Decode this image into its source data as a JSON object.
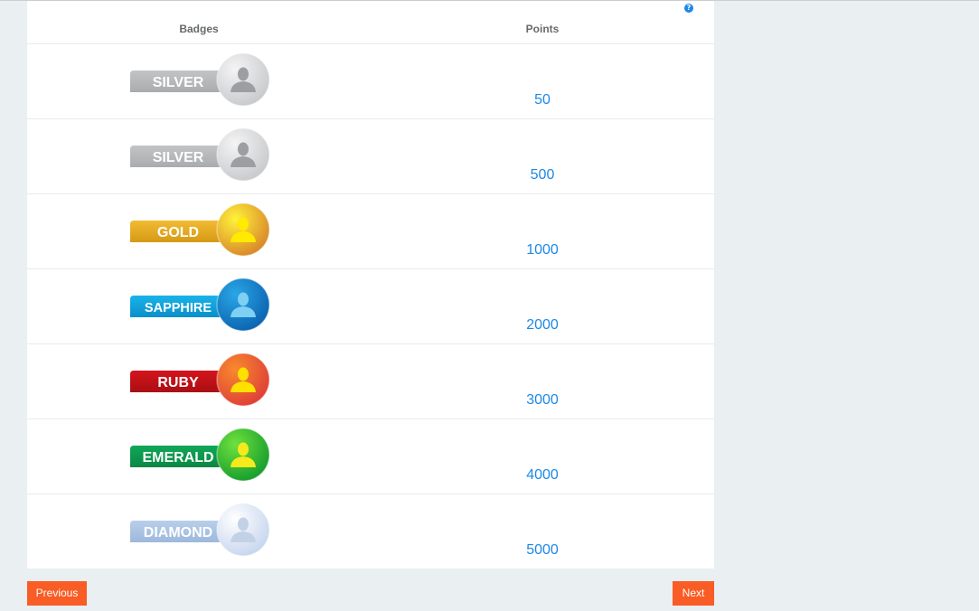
{
  "table": {
    "headers": {
      "badges": "Badges",
      "points": "Points"
    },
    "help_icon": "question-circle-icon",
    "rows": [
      {
        "badge": "SILVER",
        "points": "50",
        "ribbon": "#c2c4c6",
        "ribbon_dark": "#a9abae",
        "circle": [
          "#f4f4f5",
          "#c8c9cb"
        ],
        "person": "#9c9ea1",
        "text": "#ffffff"
      },
      {
        "badge": "SILVER",
        "points": "500",
        "ribbon": "#c2c4c6",
        "ribbon_dark": "#a9abae",
        "circle": [
          "#f4f4f5",
          "#c8c9cb"
        ],
        "person": "#9c9ea1",
        "text": "#ffffff"
      },
      {
        "badge": "GOLD",
        "points": "1000",
        "ribbon": "#f2bb33",
        "ribbon_dark": "#d59a16",
        "circle": [
          "#fff23a",
          "#d8862a"
        ],
        "person": "#ffea00",
        "text": "#ffffff"
      },
      {
        "badge": "SAPPHIRE",
        "points": "2000",
        "ribbon": "#19b3ea",
        "ribbon_dark": "#0b8fc9",
        "circle": [
          "#2aa6e6",
          "#0b63b0"
        ],
        "person": "#7fd0f3",
        "text": "#ffffff"
      },
      {
        "badge": "RUBY",
        "points": "3000",
        "ribbon": "#d4141c",
        "ribbon_dark": "#a90f14",
        "circle": [
          "#f88a2e",
          "#de3e37"
        ],
        "person": "#ffe100",
        "text": "#ffffff"
      },
      {
        "badge": "EMERALD",
        "points": "4000",
        "ribbon": "#0fa857",
        "ribbon_dark": "#0b8744",
        "circle": [
          "#6fe13e",
          "#159c2d"
        ],
        "person": "#f6ea1c",
        "text": "#ffffff"
      },
      {
        "badge": "DIAMOND",
        "points": "5000",
        "ribbon": "#b8cfea",
        "ribbon_dark": "#9db8dc",
        "circle": [
          "#ffffff",
          "#c6d5ee"
        ],
        "person": "#c3d1e6",
        "text": "#ffffff"
      }
    ]
  },
  "pagination": {
    "previous": "Previous",
    "next": "Next"
  },
  "colors": {
    "accent_button": "#f95c24",
    "points_text": "#1e88e5",
    "page_background": "#eaeff2"
  }
}
